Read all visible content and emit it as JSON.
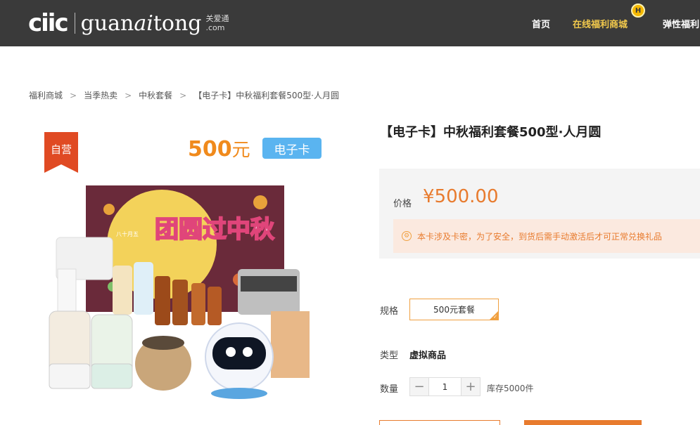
{
  "header": {
    "logo_mark": "ciic",
    "logo_text_1": "guan",
    "logo_text_ai": "ai",
    "logo_text_2": "tong",
    "logo_sub_cn": "关爱通",
    "logo_sub_domain": ".com",
    "nav": [
      {
        "label": "首页"
      },
      {
        "label": "在线福利商城"
      },
      {
        "label": "弹性福利"
      }
    ],
    "hot_badge": "H"
  },
  "breadcrumb": [
    {
      "label": "福利商城"
    },
    {
      "label": "当季热卖"
    },
    {
      "label": "中秋套餐"
    },
    {
      "label": "【电子卡】中秋福利套餐500型·人月圆"
    }
  ],
  "product_image": {
    "self_tag": "自营",
    "price_amount": "500",
    "price_unit": "元",
    "ecard_label": "电子卡",
    "poster_text": "团圆过中秋",
    "poster_corner": "八十月五"
  },
  "product": {
    "title": "【电子卡】中秋福利套餐500型·人月圆",
    "price_label": "价格",
    "price": "¥500.00",
    "notice": "本卡涉及卡密，为了安全，到货后需手动激活后才可正常兑换礼品",
    "spec_label": "规格",
    "spec_option": "500元套餐",
    "type_label": "类型",
    "type_value": "虚拟商品",
    "qty_label": "数量",
    "qty_minus": "−",
    "qty_value": "1",
    "qty_plus": "+",
    "stock": "库存5000件"
  },
  "colors": {
    "accent": "#e87b2e",
    "nav_active": "#f2c94c",
    "topbar": "#3a3a3a"
  }
}
